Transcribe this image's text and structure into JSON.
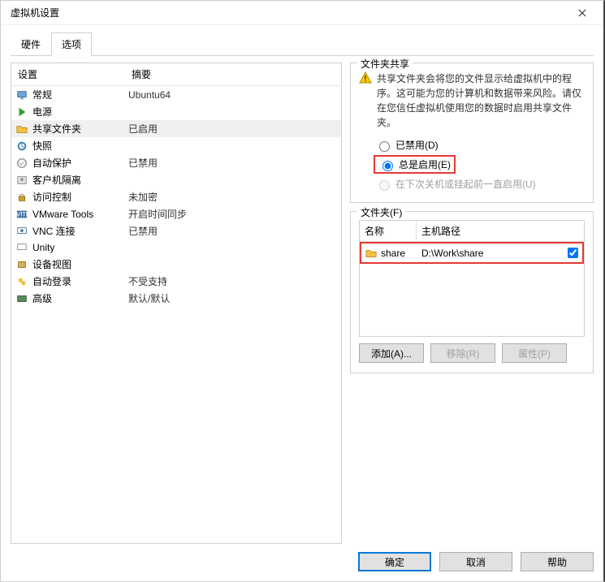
{
  "title": "虚拟机设置",
  "tabs": {
    "hardware": "硬件",
    "options": "选项"
  },
  "list": {
    "headers": {
      "setting": "设置",
      "summary": "摘要"
    },
    "rows": [
      {
        "label": "常规",
        "summary": "Ubuntu64",
        "icon": "screen"
      },
      {
        "label": "电源",
        "summary": "",
        "icon": "play"
      },
      {
        "label": "共享文件夹",
        "summary": "已启用",
        "icon": "folder-share",
        "selected": true
      },
      {
        "label": "快照",
        "summary": "",
        "icon": "snapshot"
      },
      {
        "label": "自动保护",
        "summary": "已禁用",
        "icon": "autoprotect"
      },
      {
        "label": "客户机隔离",
        "summary": "",
        "icon": "guest"
      },
      {
        "label": "访问控制",
        "summary": "未加密",
        "icon": "lock"
      },
      {
        "label": "VMware Tools",
        "summary": "开启时间同步",
        "icon": "vmw"
      },
      {
        "label": "VNC 连接",
        "summary": "已禁用",
        "icon": "vnc"
      },
      {
        "label": "Unity",
        "summary": "",
        "icon": "unity"
      },
      {
        "label": "设备视图",
        "summary": "",
        "icon": "device"
      },
      {
        "label": "自动登录",
        "summary": "不受支持",
        "icon": "autologin"
      },
      {
        "label": "高级",
        "summary": "默认/默认",
        "icon": "advanced"
      }
    ]
  },
  "share": {
    "group_title": "文件夹共享",
    "warning": "共享文件夹会将您的文件显示给虚拟机中的程序。这可能为您的计算机和数据带来风险。请仅在您信任虚拟机使用您的数据时启用共享文件夹。",
    "opt_disabled": "已禁用(D)",
    "opt_always": "总是启用(E)",
    "opt_until": "在下次关机或挂起前一直启用(U)"
  },
  "folders": {
    "group_title": "文件夹(F)",
    "headers": {
      "name": "名称",
      "path": "主机路径"
    },
    "rows": [
      {
        "name": "share",
        "path": "D:\\Work\\share",
        "checked": true
      }
    ],
    "btn_add": "添加(A)...",
    "btn_remove": "移除(R)",
    "btn_props": "属性(P)"
  },
  "footer": {
    "ok": "确定",
    "cancel": "取消",
    "help": "帮助"
  }
}
